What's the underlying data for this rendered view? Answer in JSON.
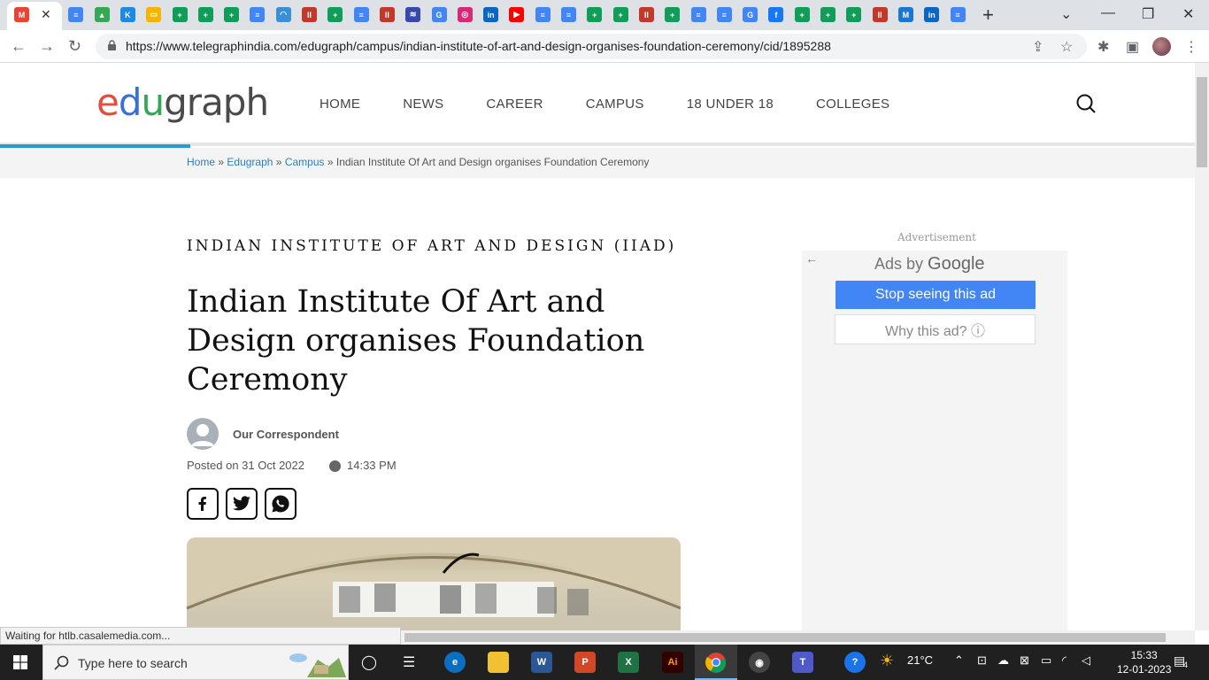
{
  "browser": {
    "tabs": [
      {
        "icon": "gmail-icon",
        "color": "#ea4335",
        "glyph": "M"
      },
      {
        "icon": "docs-icon",
        "color": "#4285f4",
        "glyph": "≡"
      },
      {
        "icon": "drive-icon",
        "color": "#34a853",
        "glyph": "▲"
      },
      {
        "icon": "k-icon",
        "color": "#1e88e5",
        "glyph": "K"
      },
      {
        "icon": "slides-icon",
        "color": "#f4b400",
        "glyph": "▭"
      },
      {
        "icon": "sheets-icon",
        "color": "#0f9d58",
        "glyph": "+"
      },
      {
        "icon": "sheets-icon",
        "color": "#0f9d58",
        "glyph": "+"
      },
      {
        "icon": "sheets-icon",
        "color": "#0f9d58",
        "glyph": "+"
      },
      {
        "icon": "docs-icon",
        "color": "#4285f4",
        "glyph": "≡"
      },
      {
        "icon": "speed-icon",
        "color": "#3b8fd6",
        "glyph": "◠"
      },
      {
        "icon": "iiad-icon",
        "color": "#c0392b",
        "glyph": "II"
      },
      {
        "icon": "sheets-icon",
        "color": "#0f9d58",
        "glyph": "+"
      },
      {
        "icon": "docs-icon",
        "color": "#4285f4",
        "glyph": "≡"
      },
      {
        "icon": "iiad-icon",
        "color": "#c0392b",
        "glyph": "II"
      },
      {
        "icon": "stripes-icon",
        "color": "#3949ab",
        "glyph": "≋"
      },
      {
        "icon": "google-icon",
        "color": "#4285f4",
        "glyph": "G"
      },
      {
        "icon": "instagram-icon",
        "color": "#d62976",
        "glyph": "◎"
      },
      {
        "icon": "linkedin-icon",
        "color": "#0a66c2",
        "glyph": "in"
      },
      {
        "icon": "youtube-icon",
        "color": "#ff0000",
        "glyph": "▶"
      },
      {
        "icon": "docs-icon",
        "color": "#4285f4",
        "glyph": "≡"
      },
      {
        "icon": "docs-icon",
        "color": "#4285f4",
        "glyph": "≡"
      },
      {
        "icon": "sheets-icon",
        "color": "#0f9d58",
        "glyph": "+"
      },
      {
        "icon": "sheets-icon",
        "color": "#0f9d58",
        "glyph": "+"
      },
      {
        "icon": "iiad-icon",
        "color": "#c0392b",
        "glyph": "II"
      },
      {
        "icon": "sheets-icon",
        "color": "#0f9d58",
        "glyph": "+"
      },
      {
        "icon": "docs-icon",
        "color": "#4285f4",
        "glyph": "≡"
      },
      {
        "icon": "docs-icon",
        "color": "#4285f4",
        "glyph": "≡"
      },
      {
        "icon": "google-icon",
        "color": "#4285f4",
        "glyph": "G"
      },
      {
        "icon": "facebook-icon",
        "color": "#1877f2",
        "glyph": "f"
      },
      {
        "icon": "sheets-icon",
        "color": "#0f9d58",
        "glyph": "+"
      },
      {
        "icon": "sheets-icon",
        "color": "#0f9d58",
        "glyph": "+"
      },
      {
        "icon": "sheets-icon",
        "color": "#0f9d58",
        "glyph": "+"
      },
      {
        "icon": "iiad-icon",
        "color": "#c0392b",
        "glyph": "II"
      },
      {
        "icon": "m-icon",
        "color": "#1976d2",
        "glyph": "M"
      },
      {
        "icon": "linkedin-icon",
        "color": "#0a66c2",
        "glyph": "in"
      },
      {
        "icon": "docs-icon",
        "color": "#4285f4",
        "glyph": "≡"
      }
    ],
    "url": "https://www.telegraphindia.com/edugraph/campus/indian-institute-of-art-and-design-organises-foundation-ceremony/cid/1895288",
    "status_text": "Waiting for htlb.casalemedia.com..."
  },
  "site": {
    "logo_e": "e",
    "logo_d": "d",
    "logo_u": "u",
    "logo_rest": "graph",
    "nav": [
      "HOME",
      "NEWS",
      "CAREER",
      "CAMPUS",
      "18 UNDER 18",
      "COLLEGES"
    ],
    "breadcrumb": {
      "home": "Home",
      "edugraph": "Edugraph",
      "campus": "Campus",
      "sep": "»",
      "current": "Indian Institute Of Art and Design organises Foundation Ceremony"
    }
  },
  "article": {
    "kicker": "INDIAN INSTITUTE OF ART AND DESIGN (IIAD)",
    "headline": "Indian Institute Of Art and Design organises Foundation Ceremony",
    "author": "Our Correspondent",
    "posted": "Posted on 31 Oct 2022",
    "time": "14:33 PM"
  },
  "ad": {
    "label": "Advertisement",
    "ads_by": "Ads by",
    "google": "Google",
    "stop": "Stop seeing this ad",
    "why": "Why this ad? ⓘ"
  },
  "taskbar": {
    "search_placeholder": "Type here to search",
    "weather": "21°C",
    "time": "15:33",
    "date": "12-01-2023",
    "notifications": "4"
  }
}
